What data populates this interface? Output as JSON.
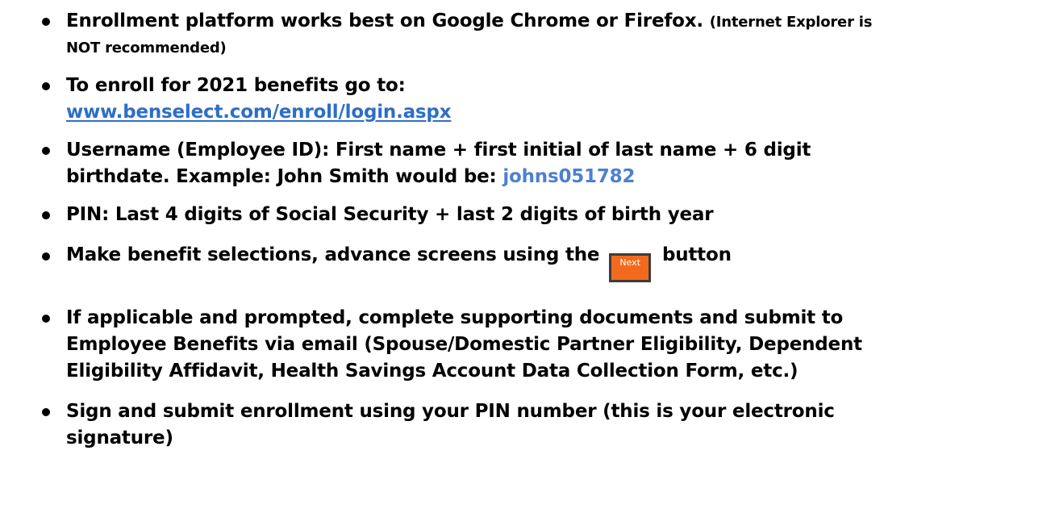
{
  "items": [
    {
      "text": "Enrollment platform works best on Google Chrome or Firefox.",
      "note_line1": "(Internet Explorer is",
      "note_line2": "NOT recommended)"
    },
    {
      "line1": "To enroll for 2021 benefits go to:",
      "link": "www.benselect.com/enroll/login.aspx"
    },
    {
      "line1": "Username (Employee ID): First name + first initial of last name + 6 digit",
      "line2": "birthdate. Example: John Smith would be:",
      "example": "johns051782"
    },
    {
      "line1": "PIN: Last 4 digits of Social Security + last 2 digits of birth year"
    },
    {
      "before": "Make benefit selections, advance screens using the",
      "button_label": "Next",
      "after": "button"
    },
    {
      "line1": "If applicable and prompted, complete supporting documents and submit to",
      "line2": "Employee Benefits via email (Spouse/Domestic Partner Eligibility, Dependent",
      "line3": "Eligibility Affidavit, Health Savings Account Data Collection Form, etc.)"
    },
    {
      "line1": "Sign and submit enrollment using your PIN number (this is your electronic",
      "line2": "signature)"
    }
  ],
  "colors": {
    "link": "#2e6ec6",
    "example": "#4f7fcf",
    "button_fill": "#f26a1d",
    "button_border": "#3c3c3c"
  }
}
